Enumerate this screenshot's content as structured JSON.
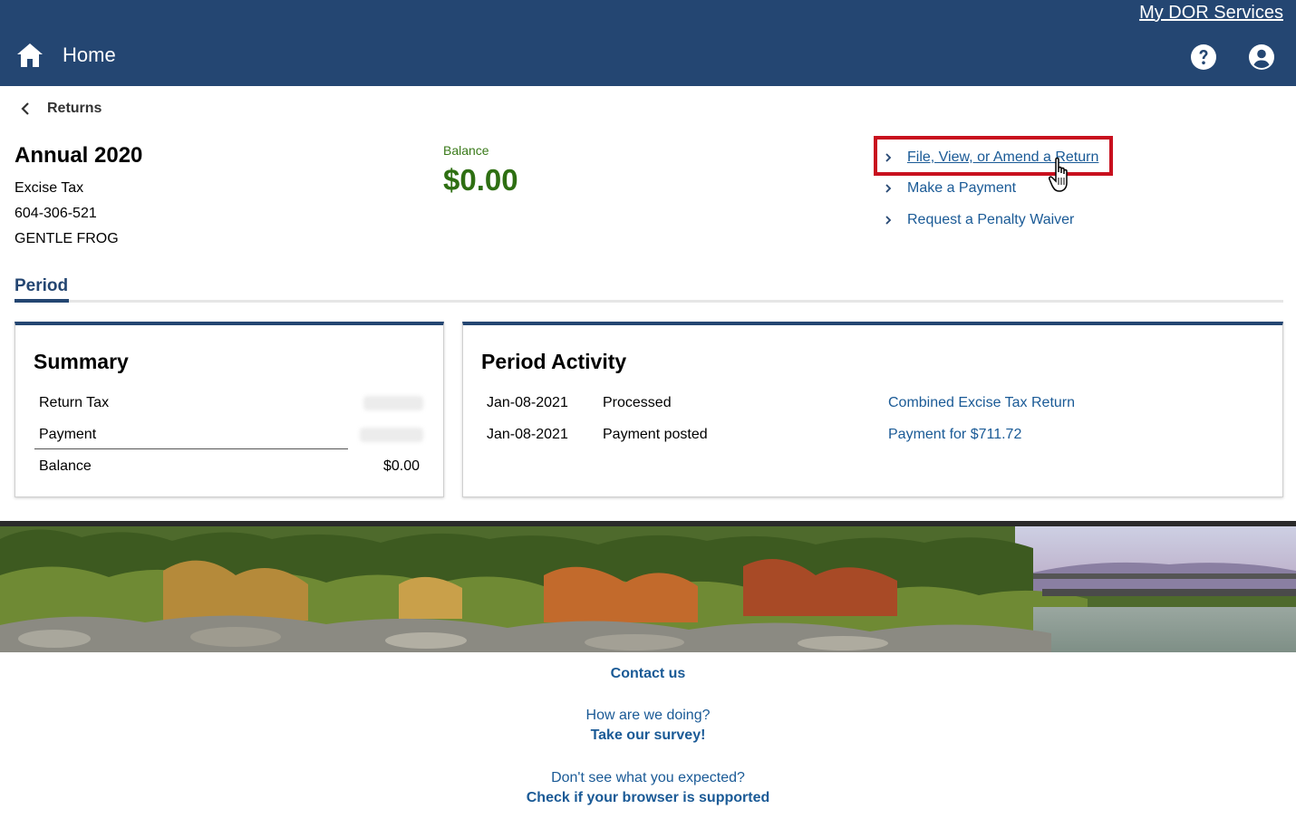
{
  "header": {
    "my_dor_services": "My DOR Services",
    "home_label": "Home",
    "icons": {
      "home": "home-icon",
      "help": "help-icon",
      "account": "account-icon"
    },
    "bar_color": "#244672"
  },
  "breadcrumb": {
    "back_label": "Returns"
  },
  "account": {
    "title": "Annual 2020",
    "tax_type": "Excise Tax",
    "account_id": "604-306-521",
    "name": "GENTLE FROG"
  },
  "balance": {
    "label": "Balance",
    "value": "$0.00",
    "color": "#2e6f12"
  },
  "actions": [
    {
      "label": "File, View, or Amend a Return",
      "highlighted": true
    },
    {
      "label": "Make a Payment"
    },
    {
      "label": "Request a Penalty Waiver"
    }
  ],
  "tabs": {
    "period": "Period"
  },
  "summary": {
    "title": "Summary",
    "rows": [
      {
        "label": "Return Tax",
        "value": ""
      },
      {
        "label": "Payment",
        "value": ""
      },
      {
        "label": "Balance",
        "value": "$0.00"
      }
    ]
  },
  "period_activity": {
    "title": "Period Activity",
    "rows": [
      {
        "date": "Jan-08-2021",
        "status": "Processed",
        "link": "Combined Excise Tax Return"
      },
      {
        "date": "Jan-08-2021",
        "status": "Payment posted",
        "link": "Payment for $711.72"
      }
    ]
  },
  "footer": {
    "contact": "Contact us",
    "doing": "How are we doing?",
    "survey": "Take our survey!",
    "expected": "Don't see what you expected?",
    "browser": "Check if your browser is supported"
  }
}
